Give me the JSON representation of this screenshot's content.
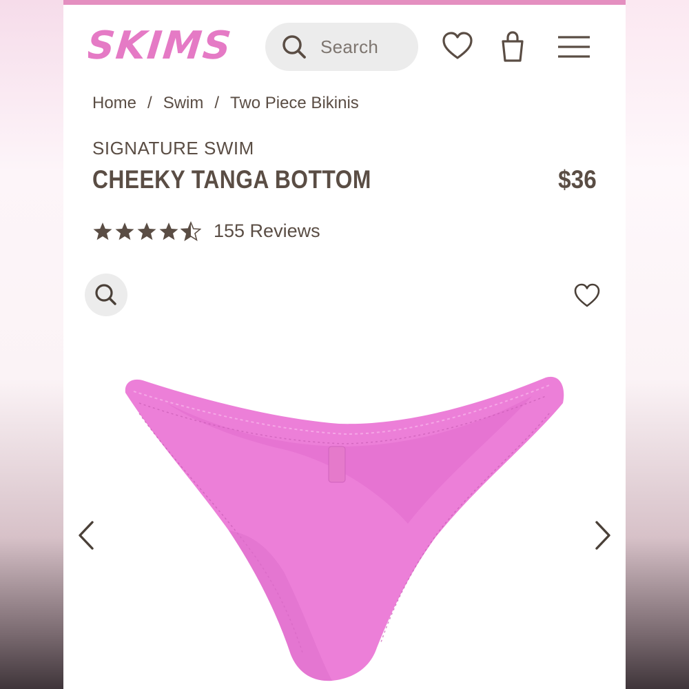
{
  "header": {
    "logo_text": "SKIMS",
    "search_placeholder": "Search",
    "icons": [
      "search-icon",
      "heart-icon",
      "shopping-bag-icon",
      "menu-icon"
    ]
  },
  "breadcrumb": {
    "items": [
      "Home",
      "Swim",
      "Two Piece Bikinis"
    ],
    "separator": "/"
  },
  "product": {
    "collection": "SIGNATURE SWIM",
    "title": "CHEEKY TANGA BOTTOM",
    "price": "$36",
    "rating": 4.5,
    "reviews_label": "155 Reviews",
    "image_alt": "pink bikini bottom",
    "image_color": "#ec7fd8"
  },
  "colors": {
    "brand_pink": "#e57ac5",
    "text_brown": "#5a4d44",
    "top_bar": "#e48fc0"
  }
}
